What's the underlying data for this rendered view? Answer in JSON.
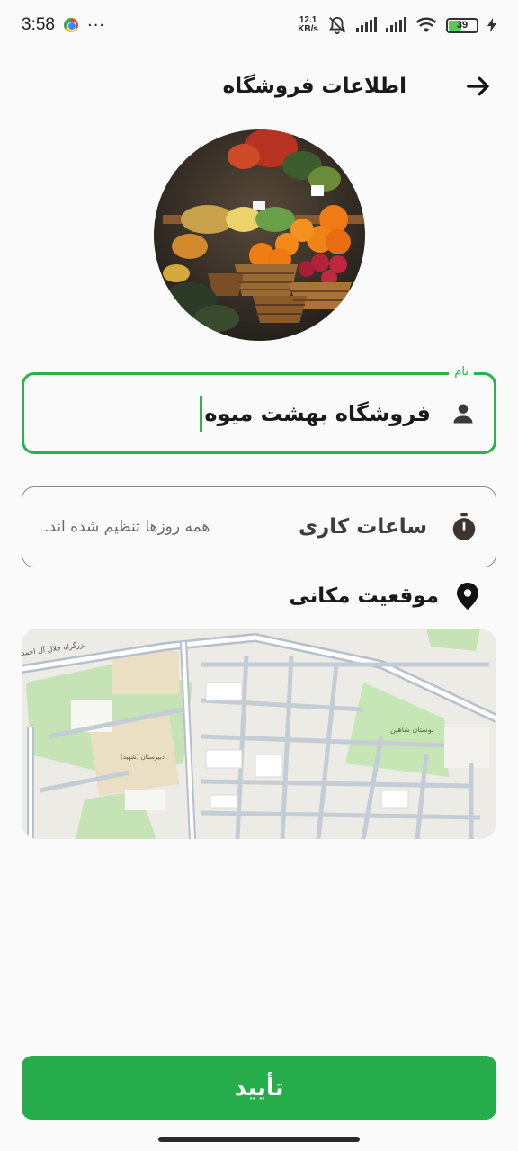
{
  "status_bar": {
    "time": "3:58",
    "more": "···",
    "net_speed_value": "12.1",
    "net_speed_unit": "KB/s",
    "battery": "39"
  },
  "header": {
    "title": "اطلاعات فروشگاه"
  },
  "form": {
    "name_label": "نام",
    "name_value": "فروشگاه بهشت میوه",
    "hours_label": "ساعات کاری",
    "hours_value": "همه روزها تنظیم شده اند.",
    "location_label": "موقعیت مکانی"
  },
  "map": {
    "labels": [
      "بزرگراه جلال آل احمد",
      "بوستان شاهین",
      "دبیرستان (شهید)"
    ]
  },
  "confirm_button": "تأیید",
  "colors": {
    "accent": "#26ac4a",
    "background": "#fafafa"
  }
}
